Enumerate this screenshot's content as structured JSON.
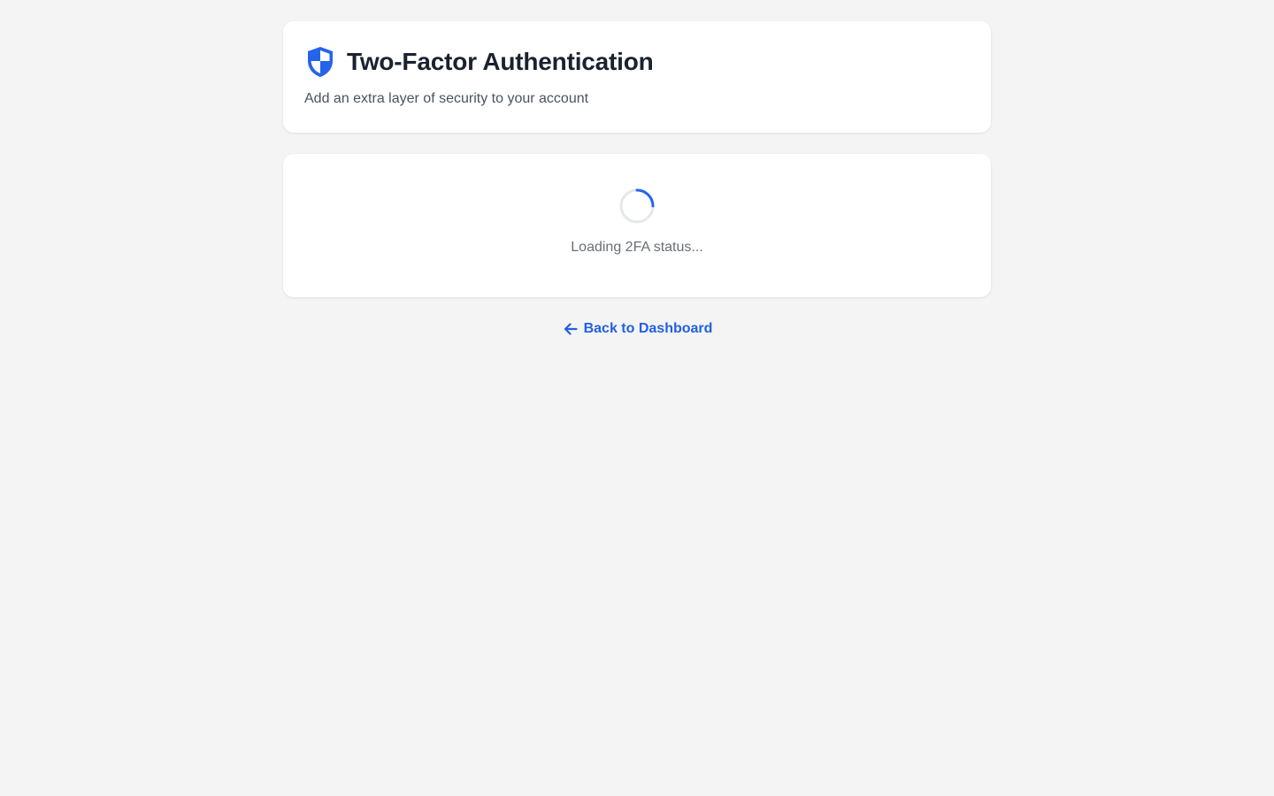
{
  "header": {
    "title": "Two-Factor Authentication",
    "subtitle": "Add an extra layer of security to your account",
    "icon": "shield-icon"
  },
  "status": {
    "loading_text": "Loading 2FA status...",
    "icon": "spinner-icon"
  },
  "navigation": {
    "back_label": "Back to Dashboard",
    "icon": "arrow-left-icon"
  },
  "colors": {
    "accent": "#2563eb",
    "background": "#f4f4f4",
    "card": "#ffffff",
    "title": "#1a2230",
    "muted": "#6b6f76"
  }
}
